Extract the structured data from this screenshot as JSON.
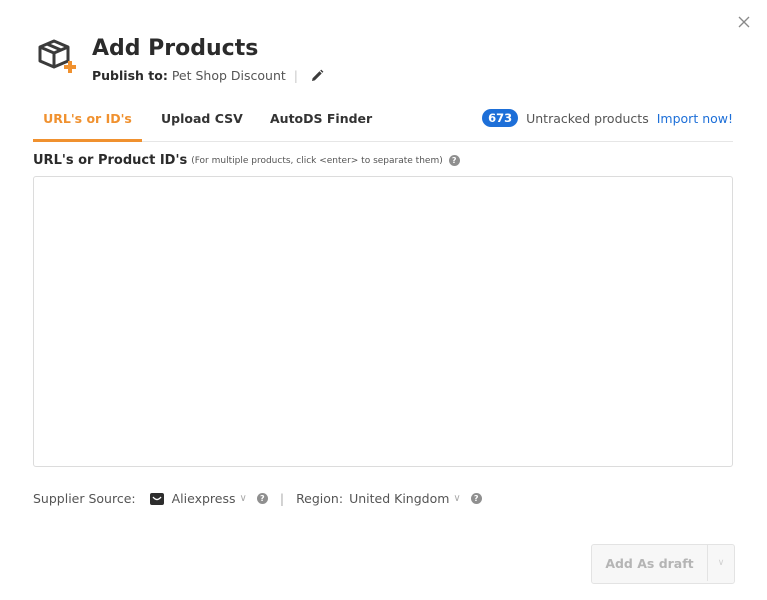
{
  "header": {
    "title": "Add Products",
    "publish_label": "Publish to:",
    "store_name": "Pet Shop Discount",
    "separator": "|"
  },
  "tabs": [
    {
      "label": "URL's or ID's",
      "active": true
    },
    {
      "label": "Upload CSV",
      "active": false
    },
    {
      "label": "AutoDS Finder",
      "active": false
    }
  ],
  "untracked": {
    "count": "673",
    "text": "Untracked products",
    "link": "Import now!"
  },
  "field": {
    "label": "URL's or Product ID's",
    "hint": "(For multiple products, click <enter> to separate them)",
    "value": "",
    "placeholder": ""
  },
  "supplier": {
    "label": "Supplier Source:",
    "value": "Aliexpress",
    "separator": "|",
    "region_label": "Region:",
    "region_value": "United Kingdom"
  },
  "actions": {
    "add_label": "Add As draft"
  },
  "icons": {
    "close": "close-icon",
    "box": "package-add-icon",
    "edit": "pencil-icon",
    "help": "help-icon",
    "supplier": "aliexpress-icon",
    "chevron": "chevron-down-icon"
  },
  "colors": {
    "accent": "#f0912f",
    "badge": "#1d6fd8",
    "link": "#1d6fd8"
  }
}
